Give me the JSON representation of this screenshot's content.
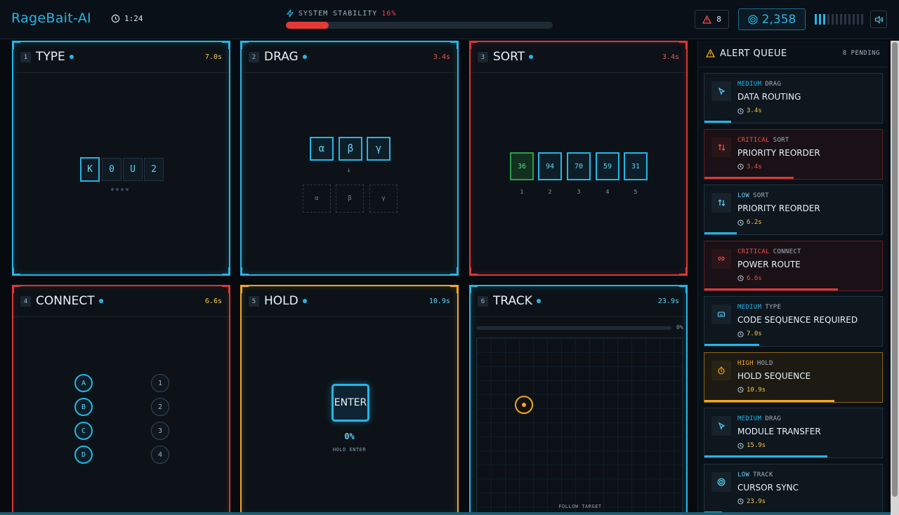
{
  "header": {
    "brand": "RageBait-AI",
    "timer": "1:24",
    "stability_label": "SYSTEM STABILITY",
    "stability_pct": "16%",
    "stability_value": 0.16,
    "alert_count": "8",
    "score": "2,358",
    "level_on": 3,
    "level_total": 12
  },
  "panels": {
    "type": {
      "num": "1",
      "title": "TYPE",
      "time": "7.0s",
      "chars": [
        "K",
        "0",
        "U",
        "2"
      ]
    },
    "drag": {
      "num": "2",
      "title": "DRAG",
      "time": "3.4s",
      "sources": [
        "α",
        "β",
        "γ"
      ],
      "arrow": "↓",
      "targets": [
        "α",
        "β",
        "γ"
      ]
    },
    "sort": {
      "num": "3",
      "title": "SORT",
      "time": "3.4s",
      "values": [
        "36",
        "94",
        "70",
        "59",
        "31"
      ],
      "indices": [
        "1",
        "2",
        "3",
        "4",
        "5"
      ]
    },
    "connect": {
      "num": "4",
      "title": "CONNECT",
      "time": "6.6s",
      "left": [
        "A",
        "B",
        "C",
        "D"
      ],
      "right": [
        "1",
        "2",
        "3",
        "4"
      ]
    },
    "hold": {
      "num": "5",
      "title": "HOLD",
      "time": "10.9s",
      "key": "ENTER",
      "progress": "0%",
      "hint": "HOLD ENTER"
    },
    "track": {
      "num": "6",
      "title": "TRACK",
      "time": "23.9s",
      "progress": "0%",
      "hint": "FOLLOW TARGET"
    }
  },
  "queue": {
    "title": "ALERT QUEUE",
    "pending": "8 PENDING",
    "alerts": [
      {
        "severity": "MEDIUM",
        "category": "DRAG",
        "name": "DATA ROUTING",
        "time": "3.4s",
        "progress": 0.15
      },
      {
        "severity": "CRITICAL",
        "category": "SORT",
        "name": "PRIORITY REORDER",
        "time": "3.4s",
        "progress": 0.5
      },
      {
        "severity": "LOW",
        "category": "SORT",
        "name": "PRIORITY REORDER",
        "time": "6.2s",
        "progress": 0.18
      },
      {
        "severity": "CRITICAL",
        "category": "CONNECT",
        "name": "POWER ROUTE",
        "time": "6.6s",
        "progress": 0.75
      },
      {
        "severity": "MEDIUM",
        "category": "TYPE",
        "name": "CODE SEQUENCE REQUIRED",
        "time": "7.0s",
        "progress": 0.31
      },
      {
        "severity": "HIGH",
        "category": "HOLD",
        "name": "HOLD SEQUENCE",
        "time": "10.9s",
        "progress": 0.73
      },
      {
        "severity": "MEDIUM",
        "category": "DRAG",
        "name": "MODULE TRANSFER",
        "time": "15.9s",
        "progress": 0.69
      },
      {
        "severity": "LOW",
        "category": "TRACK",
        "name": "CURSOR SYNC",
        "time": "23.9s",
        "progress": 0.1
      }
    ]
  },
  "colors": {
    "accent": "#22b7e6",
    "critical": "#d93838",
    "warning": "#f2a81d",
    "success": "#2e9e4c"
  }
}
